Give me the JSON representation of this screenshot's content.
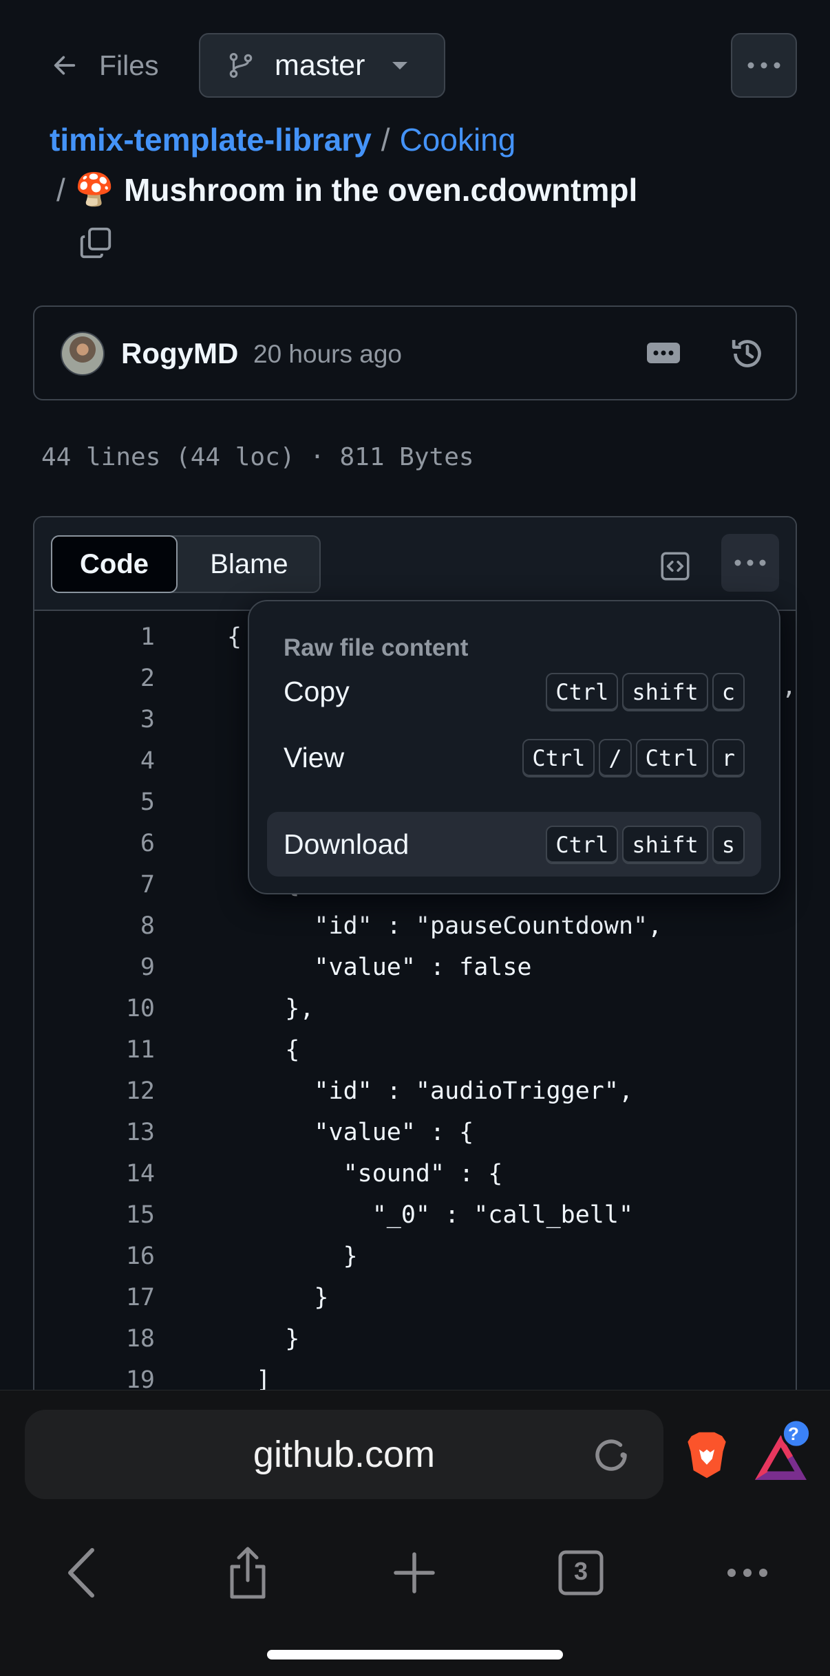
{
  "header": {
    "back_label": "Files",
    "branch": "master"
  },
  "breadcrumb": {
    "repo": "timix-template-library",
    "separator": "/",
    "dir": "Cooking",
    "file_emoji": "🍄",
    "filename": "Mushroom in the oven.cdowntmpl"
  },
  "commit": {
    "author": "RogyMD",
    "time": "20 hours ago"
  },
  "file_info": "44 lines (44 loc) · 811 Bytes",
  "code_view": {
    "tabs": [
      "Code",
      "Blame"
    ],
    "active_tab": "Code"
  },
  "code_lines": [
    {
      "n": "1",
      "text": "{"
    },
    {
      "n": "2",
      "text": ""
    },
    {
      "n": "3",
      "text": ""
    },
    {
      "n": "4",
      "text": ""
    },
    {
      "n": "5",
      "text": ""
    },
    {
      "n": "6",
      "text": ""
    },
    {
      "n": "7",
      "text": "    {"
    },
    {
      "n": "8",
      "text": "      \"id\" : \"pauseCountdown\","
    },
    {
      "n": "9",
      "text": "      \"value\" : false"
    },
    {
      "n": "10",
      "text": "    },"
    },
    {
      "n": "11",
      "text": "    {"
    },
    {
      "n": "12",
      "text": "      \"id\" : \"audioTrigger\","
    },
    {
      "n": "13",
      "text": "      \"value\" : {"
    },
    {
      "n": "14",
      "text": "        \"sound\" : {"
    },
    {
      "n": "15",
      "text": "          \"_0\" : \"call_bell\""
    },
    {
      "n": "16",
      "text": "        }"
    },
    {
      "n": "17",
      "text": "      }"
    },
    {
      "n": "18",
      "text": "    }"
    },
    {
      "n": "19",
      "text": "  ]"
    }
  ],
  "partial_line_2_tail": ",",
  "menu": {
    "title": "Raw file content",
    "items": [
      {
        "label": "Copy",
        "keys": [
          "Ctrl",
          "shift",
          "c"
        ]
      },
      {
        "label": "View",
        "keys": [
          "Ctrl",
          "/",
          "Ctrl",
          "r"
        ]
      },
      {
        "label": "Download",
        "keys": [
          "Ctrl",
          "shift",
          "s"
        ],
        "highlighted": true
      }
    ]
  },
  "browser": {
    "url": "github.com",
    "tab_count": "3",
    "rewards_badge": "?"
  },
  "colors": {
    "background": "#0d1117",
    "link": "#4493f8",
    "muted": "#9198a1",
    "border": "#3d444d"
  }
}
